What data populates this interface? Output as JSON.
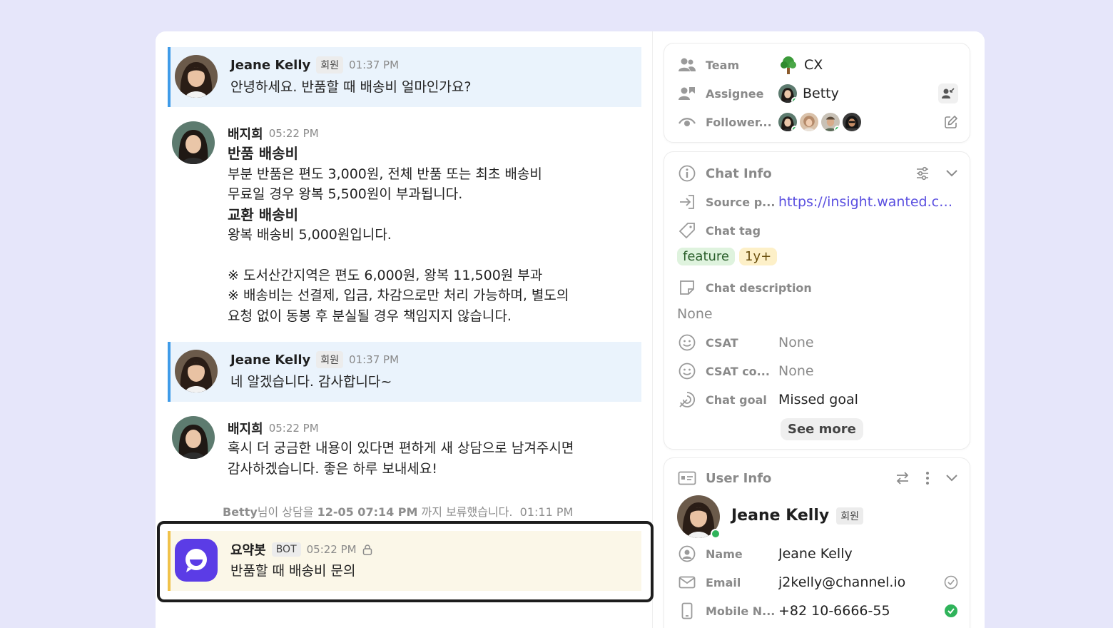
{
  "messages": [
    {
      "name": "Jeane Kelly",
      "badge": "회원",
      "time": "01:37 PM",
      "lines": [
        "안녕하세요. 반품할 때 배송비 얼마인가요?"
      ]
    },
    {
      "name": "배지희",
      "time": "05:22 PM",
      "heading1": "반품 배송비",
      "para1": [
        "부분 반품은 편도 3,000원, 전체 반품 또는 최초 배송비",
        "무료일 경우 왕복 5,500원이 부과됩니다."
      ],
      "heading2": "교환 배송비",
      "para2": [
        "왕복 배송비 5,000원입니다."
      ],
      "notes": [
        "※ 도서산간지역은 편도 6,000원, 왕복 11,500원 부과",
        "※ 배송비는 선결제, 입금, 차감으로만 처리 가능하며, 별도의",
        "요청 없이 동봉 후 분실될 경우 책임지지 않습니다."
      ]
    },
    {
      "name": "Jeane Kelly",
      "badge": "회원",
      "time": "01:37 PM",
      "lines": [
        "네 알겠습니다. 감사합니다~"
      ]
    },
    {
      "name": "배지희",
      "time": "05:22 PM",
      "lines": [
        "혹시 더 궁금한 내용이 있다면 편하게 새 상담으로 남겨주시면",
        "감사하겠습니다. 좋은 하루 보내세요!"
      ]
    },
    {
      "name": "요약봇",
      "badge": "BOT",
      "time": "05:22 PM",
      "lines": [
        "반품할 때 배송비 문의"
      ]
    }
  ],
  "status": {
    "actor": "Betty",
    "text1": "님이 상담을",
    "date": "12-05 07:14 PM",
    "text2": "까지 보류했습니다.",
    "time": "01:11 PM"
  },
  "team_card": {
    "team_label": "Team",
    "team_value": "CX",
    "assignee_label": "Assignee",
    "assignee_value": "Betty",
    "followers_label": "Follower..."
  },
  "chat_info": {
    "title": "Chat Info",
    "source_label": "Source p...",
    "source_value": "https://insight.wanted.co...",
    "tag_label": "Chat tag",
    "tags": [
      "feature",
      "1y+"
    ],
    "desc_label": "Chat description",
    "desc_value": "None",
    "csat_label": "CSAT",
    "csat_value": "None",
    "csat_comment_label": "CSAT co...",
    "csat_comment_value": "None",
    "goal_label": "Chat goal",
    "goal_value": "Missed goal",
    "see_more": "See more"
  },
  "user_info": {
    "title": "User Info",
    "name": "Jeane Kelly",
    "badge": "회원",
    "name_label": "Name",
    "name_value": "Jeane Kelly",
    "email_label": "Email",
    "email_value": "j2kelly@channel.io",
    "mobile_label": "Mobile N...",
    "mobile_value": "+82 10-6666-55"
  },
  "colors": {
    "accent_user": "#3f9be8",
    "accent_bot": "#f0c24a",
    "link": "#5a4fe0",
    "online": "#2fb35a",
    "bot_brand": "#5b3ce6"
  }
}
